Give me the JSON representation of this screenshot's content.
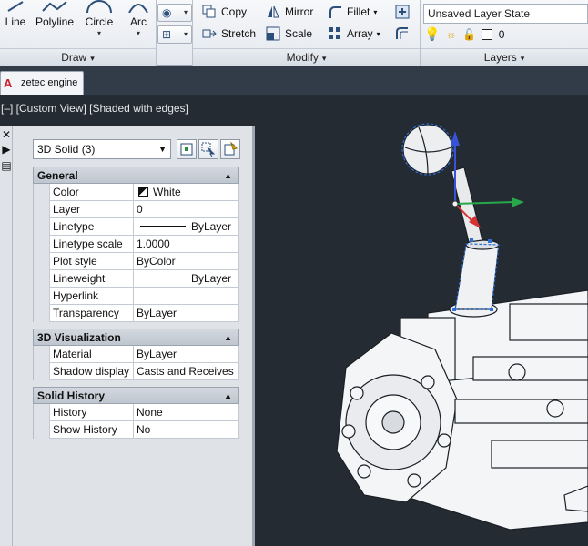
{
  "ribbon": {
    "draw": {
      "title": "Draw",
      "tools": [
        {
          "label": "Line"
        },
        {
          "label": "Polyline"
        },
        {
          "label": "Circle"
        },
        {
          "label": "Arc"
        }
      ]
    },
    "modify": {
      "title": "Modify",
      "buttons": [
        {
          "label": "Copy"
        },
        {
          "label": "Mirror"
        },
        {
          "label": "Fillet"
        },
        {
          "label": "Stretch"
        },
        {
          "label": "Scale"
        },
        {
          "label": "Array"
        }
      ]
    },
    "layers": {
      "title": "Layers",
      "layer_state": "Unsaved Layer State",
      "current_layer": "0"
    }
  },
  "file_tab": {
    "label": "zetec engine"
  },
  "viewport": {
    "label": "[–] [Custom View] [Shaded with edges]"
  },
  "palette": {
    "selection": "3D Solid (3)",
    "sections": {
      "general": {
        "title": "General",
        "rows": [
          {
            "name": "Color",
            "value": "White"
          },
          {
            "name": "Layer",
            "value": "0"
          },
          {
            "name": "Linetype",
            "value": "ByLayer"
          },
          {
            "name": "Linetype scale",
            "value": "1.0000"
          },
          {
            "name": "Plot style",
            "value": "ByColor"
          },
          {
            "name": "Lineweight",
            "value": "ByLayer"
          },
          {
            "name": "Hyperlink",
            "value": ""
          },
          {
            "name": "Transparency",
            "value": "ByLayer"
          }
        ]
      },
      "visualization": {
        "title": "3D Visualization",
        "rows": [
          {
            "name": "Material",
            "value": "ByLayer"
          },
          {
            "name": "Shadow display",
            "value": "Casts and Receives ..."
          }
        ]
      },
      "history": {
        "title": "Solid History",
        "rows": [
          {
            "name": "History",
            "value": "None"
          },
          {
            "name": "Show History",
            "value": "No"
          }
        ]
      }
    }
  }
}
